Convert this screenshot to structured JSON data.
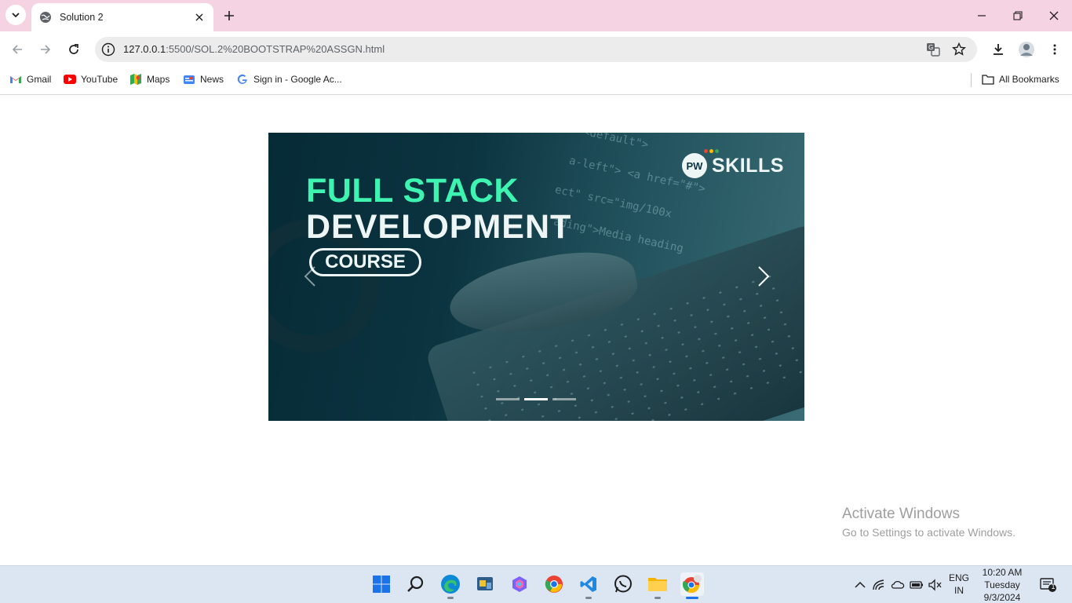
{
  "browser": {
    "tab_title": "Solution 2",
    "url_host": "127.0.0.1",
    "url_rest": ":5500/SOL.2%20BOOTSTRAP%20ASSGN.html"
  },
  "bookmarks": {
    "items": [
      {
        "label": "Gmail",
        "icon": "gmail-icon"
      },
      {
        "label": "YouTube",
        "icon": "youtube-icon"
      },
      {
        "label": "Maps",
        "icon": "maps-icon"
      },
      {
        "label": "News",
        "icon": "news-icon"
      },
      {
        "label": "Sign in - Google Ac...",
        "icon": "google-icon"
      }
    ],
    "all_bookmarks": "All Bookmarks"
  },
  "carousel": {
    "headline_line1": "FULL STACK",
    "headline_line2": "DEVELOPMENT",
    "course_label": "COURSE",
    "brand_logo_text": "PW",
    "brand_name": "SKILLS",
    "active_slide": 2,
    "slide_count": 3,
    "colors": {
      "accent": "#3df5b0",
      "bg": "#0b3440"
    }
  },
  "watermark": {
    "line1": "Activate Windows",
    "line2": "Go to Settings to activate Windows."
  },
  "taskbar": {
    "icons": [
      "windows-start-icon",
      "search-icon",
      "edge-icon",
      "file-manager-icon",
      "copilot-icon",
      "chrome-icon",
      "vscode-icon",
      "whatsapp-icon",
      "folder-icon",
      "chrome-profile-icon"
    ],
    "lang_line1": "ENG",
    "lang_line2": "IN",
    "time": "10:20 AM",
    "day": "Tuesday",
    "date": "9/3/2024",
    "notification_count": "1"
  }
}
